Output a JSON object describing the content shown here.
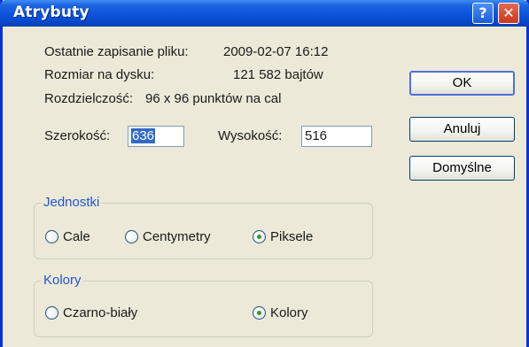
{
  "window": {
    "title": "Atrybuty",
    "help_glyph": "?",
    "close_glyph": "✕"
  },
  "info": {
    "last_saved_label": "Ostatnie zapisanie pliku:",
    "last_saved_value": "2009-02-07 16:12",
    "disk_size_label": "Rozmiar na dysku:",
    "disk_size_value": "121 582 bajtów",
    "resolution_label": "Rozdzielczość:",
    "resolution_value": "96 x 96 punktów na cal"
  },
  "fields": {
    "width_label": "Szerokość:",
    "width_value": "636",
    "height_label": "Wysokość:",
    "height_value": "516"
  },
  "units": {
    "legend": "Jednostki",
    "options": [
      "Cale",
      "Centymetry",
      "Piksele"
    ],
    "selected": "Piksele"
  },
  "colors": {
    "legend": "Kolory",
    "options": [
      "Czarno-biały",
      "Kolory"
    ],
    "selected": "Kolory"
  },
  "buttons": {
    "ok": "OK",
    "cancel": "Anuluj",
    "default": "Domyślne"
  }
}
